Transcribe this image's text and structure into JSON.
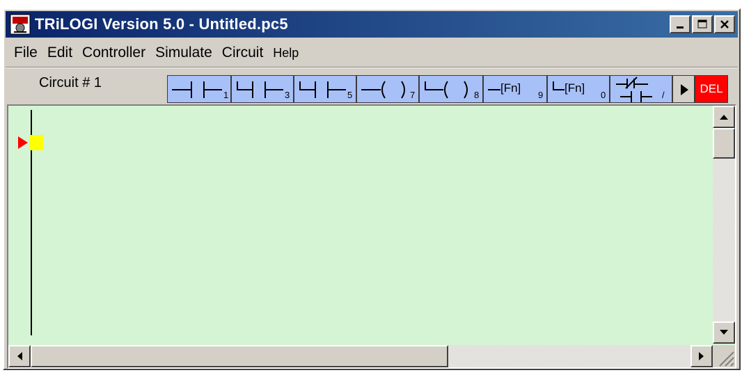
{
  "window": {
    "title": "TRiLOGI Version 5.0 - Untitled.pc5"
  },
  "menu": {
    "items": [
      "File",
      "Edit",
      "Controller",
      "Simulate",
      "Circuit",
      "Help"
    ]
  },
  "toolbar": {
    "circuit_label": "Circuit # 1",
    "buttons": [
      {
        "name": "contact-series-button",
        "hint": "1"
      },
      {
        "name": "contact-parallel-button",
        "hint": "3"
      },
      {
        "name": "contact-node-button",
        "hint": "5"
      },
      {
        "name": "coil-button",
        "hint": "7"
      },
      {
        "name": "coil-parallel-button",
        "hint": "8"
      },
      {
        "name": "function-button",
        "hint": "9"
      },
      {
        "name": "function-parallel-button",
        "hint": "0"
      },
      {
        "name": "invert-contact-button",
        "hint": "/"
      }
    ],
    "fn_label": "[Fn]",
    "play_icon": "play-icon",
    "del_label": "DEL"
  },
  "colors": {
    "title_start": "#0a246a",
    "title_end": "#3a6ea5",
    "editor_bg": "#d4f4d4",
    "toolbar_button": "#a8c0f8",
    "del_button": "#ff0000",
    "cursor_marker": "#ffff00",
    "cursor_arrow": "#ff0000"
  }
}
